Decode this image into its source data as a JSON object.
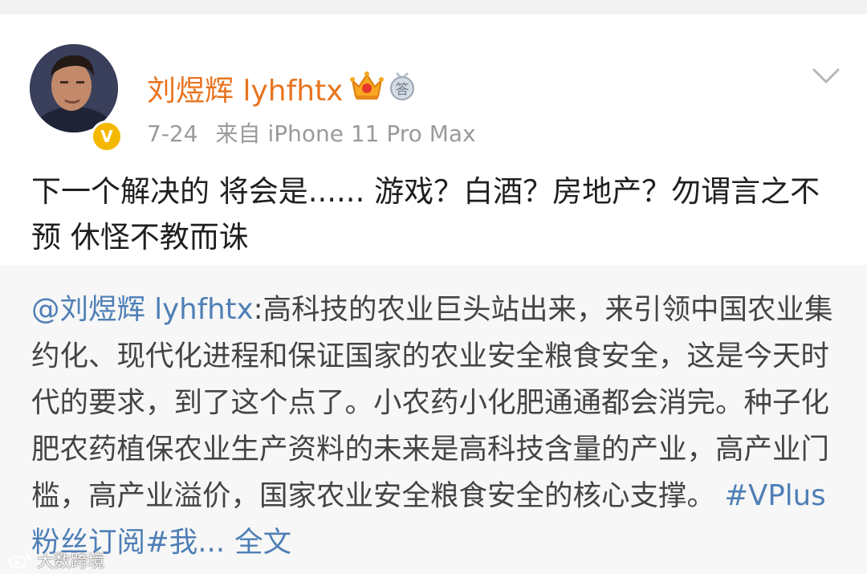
{
  "post": {
    "author": {
      "name": "刘煜辉 lyhfhtx",
      "verified_badge": "V",
      "crown_icon": "vip-crown-icon",
      "answer_badge_icon": "answer-badge-icon",
      "answer_badge_text": "答"
    },
    "meta": {
      "date": "7-24",
      "source": "来自 iPhone 11 Pro Max"
    },
    "text": "下一个解决的 将会是...... 游戏？白酒？房地产？勿谓言之不预 休怪不教而诛"
  },
  "repost": {
    "mention": "@刘煜辉 lyhfhtx",
    "body": ":高科技的农业巨头站出来，来引领中国农业集约化、现代化进程和保证国家的农业安全粮食安全，这是今天时代的要求，到了这个点了。小农药小化肥通通都会消完。种子化肥农药植保农业生产资料的未来是高科技含量的产业，高产业门槛，高产业溢价，国家农业安全粮食安全的核心支撑。",
    "hashtag": "#VPlus粉丝订阅#我...",
    "full_text_link": "全文"
  },
  "watermark": {
    "text": "大数跨境",
    "icon": "weibo-logo-icon"
  },
  "colors": {
    "name": "#e8741f",
    "link": "#4f7fb6",
    "badge": "#f5b800"
  }
}
